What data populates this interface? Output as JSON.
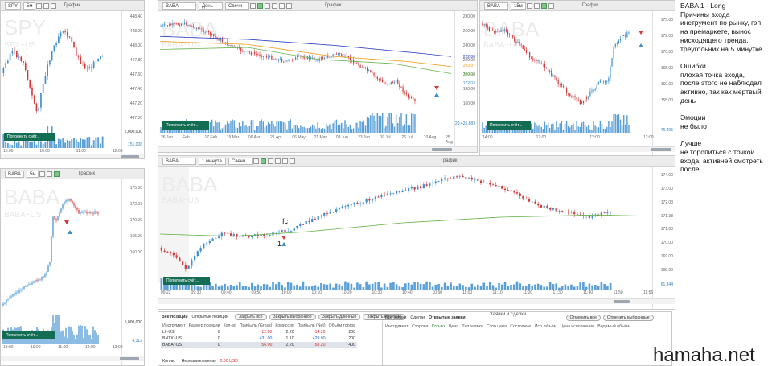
{
  "colors": {
    "up": "#3b8fd0",
    "down": "#d23a3a",
    "ma_green": "#67b34b",
    "ma_orange": "#f0a020",
    "ma_blue": "#2b3fbf",
    "volume": "#5a9fd8",
    "deposit": "#136d53"
  },
  "panels": {
    "spy": {
      "symbol": "SPY",
      "interval": "5м",
      "mode": "График",
      "watermark": "SPY",
      "watermark_sub": "SPY~US",
      "yticks": [
        "448.40",
        "448.20",
        "448.00",
        "447.80",
        "447.60",
        "447.40",
        "447.20",
        "447.00"
      ],
      "last_price": "448.00",
      "vol_top": "2,000,000",
      "vol_last": "151,006",
      "xticks": [
        "15:00",
        "10:00",
        "11:00",
        "12:00"
      ],
      "deposit": "Пополнить счёт..."
    },
    "baba_day": {
      "symbol": "BABA",
      "interval": "День",
      "style": "Свечи",
      "mode": "График",
      "watermark": "BABA",
      "watermark_sub": "BABA~US",
      "yticks": [
        "280.00",
        "260.00",
        "240.00",
        "220.00",
        "200.00",
        "180.00",
        "160.00"
      ],
      "ma_labels": [
        "222.80",
        "209.97",
        "189.91",
        "172.03"
      ],
      "vol_last": "29,425,883",
      "xticks": [
        "26 Jan",
        "Feb",
        "17 Feb",
        "19 Mar",
        "06 Apr",
        "21 Apr",
        "06 May",
        "21 May",
        "08 Jun",
        "23 Jun",
        "09 Jul",
        "26 Jul",
        "10 Aug",
        "25 Aug"
      ],
      "deposit": "Пополнить счёт..."
    },
    "baba_15": {
      "symbol": "BABA",
      "interval": "15м",
      "mode": "График",
      "watermark": "BABA",
      "watermark_sub": "BABA~US",
      "yticks": [
        "175.00",
        "172.03",
        "170.00",
        "165.00",
        "160.00",
        "155.00"
      ],
      "vol_last": "76,405",
      "xticks": [
        "14:00",
        "12:00",
        "12:00",
        "12:00"
      ],
      "deposit": "Пополнить счёт..."
    },
    "baba_5": {
      "symbol": "BABA",
      "interval": "5м",
      "mode": "График",
      "watermark": "BABA",
      "watermark_sub": "BABA~US",
      "yticks": [
        "175.00",
        "172.03",
        "170.00",
        "165.00",
        "160.00"
      ],
      "vol_top": "5,000,000",
      "vol_last": "4,312",
      "xticks": [
        "13:00",
        "10:00",
        "11:00",
        "12:00",
        "13:00"
      ],
      "deposit": "Пополнить счёт..."
    },
    "baba_1": {
      "symbol": "BABA",
      "interval": "1 минута",
      "style": "Свечи",
      "mode": "График",
      "watermark": "BABA",
      "watermark_sub": "BABA~US",
      "yticks": [
        "174.00",
        "173.00",
        "172.03",
        "171.38",
        "171.00",
        "170.00",
        "169.00",
        "168.00"
      ],
      "vol_last": "61,344",
      "xticks": [
        "09:22",
        "09:30",
        "09:40",
        "09:50",
        "10:00",
        "10:10",
        "10:20",
        "10:30",
        "10:40",
        "10:50",
        "11:00",
        "11:10",
        "11:20",
        "11:30",
        "11:40",
        "11:50",
        "11:56"
      ],
      "annotation": "fc",
      "entry_label": "1",
      "deposit": "Пополнить счёт..."
    }
  },
  "positions": {
    "tabs": [
      "Все позиции",
      "Открытые позиции"
    ],
    "buttons": [
      "Закрыть все",
      "Закрыть выбранное",
      "Закрыть длинные",
      "Закрыть короткие"
    ],
    "headers": [
      "Инструмент",
      "Размер позиции",
      "Кол-во",
      "Прибыль (Gross)",
      "Комиссия",
      "Прибыль (Net)",
      "Объём торгов"
    ],
    "rows": [
      {
        "symbol": "LI~US",
        "size": "0",
        "qty": "",
        "gross": "-12.00",
        "commission": "2.20",
        "net": "-14.20",
        "volume": "200"
      },
      {
        "symbol": "BNTX~US",
        "size": "0",
        "qty": "",
        "gross": "431.00",
        "commission": "1.10",
        "net": "429.90",
        "volume": "200"
      },
      {
        "symbol": "BABA~US",
        "size": "0",
        "qty": "",
        "gross": "-56.00",
        "commission": "2.20",
        "net": "-58.20",
        "volume": "400"
      }
    ],
    "footer_qty": "Кол-во",
    "footer_unrealized": "Нереализованная",
    "footer_value": "0.00 USD"
  },
  "orders": {
    "title": "Заявки и сделки",
    "tabs": [
      "Все заявки",
      "Сделки",
      "Открытые заявки"
    ],
    "buttons": [
      "Отменить все",
      "Отменить выбранные"
    ],
    "headers": [
      "Инструмент",
      "Сторона",
      "Кол-во",
      "Цена",
      "Тип заявки",
      "Стоп цена",
      "Состояние",
      "Исп. объём",
      "Цена исполнения",
      "Видимый объём"
    ]
  },
  "note": "BABA 1 - Long\nПричины входа\nинструмент по рынку, гэп\nна премаркете, вынос\nнисходящего тренда,\nтреугольник на 5 минутке\n\nОшибки\nплохая точка входа,\nпосле этого не наблюдал\nактивно, так как мертвый\nдень\n\nЭмоции\nне было\n\nЛучше\nне торопиться с точкой\nвхода, активней смотреть\nпосле",
  "brand": "hamaha.net"
}
